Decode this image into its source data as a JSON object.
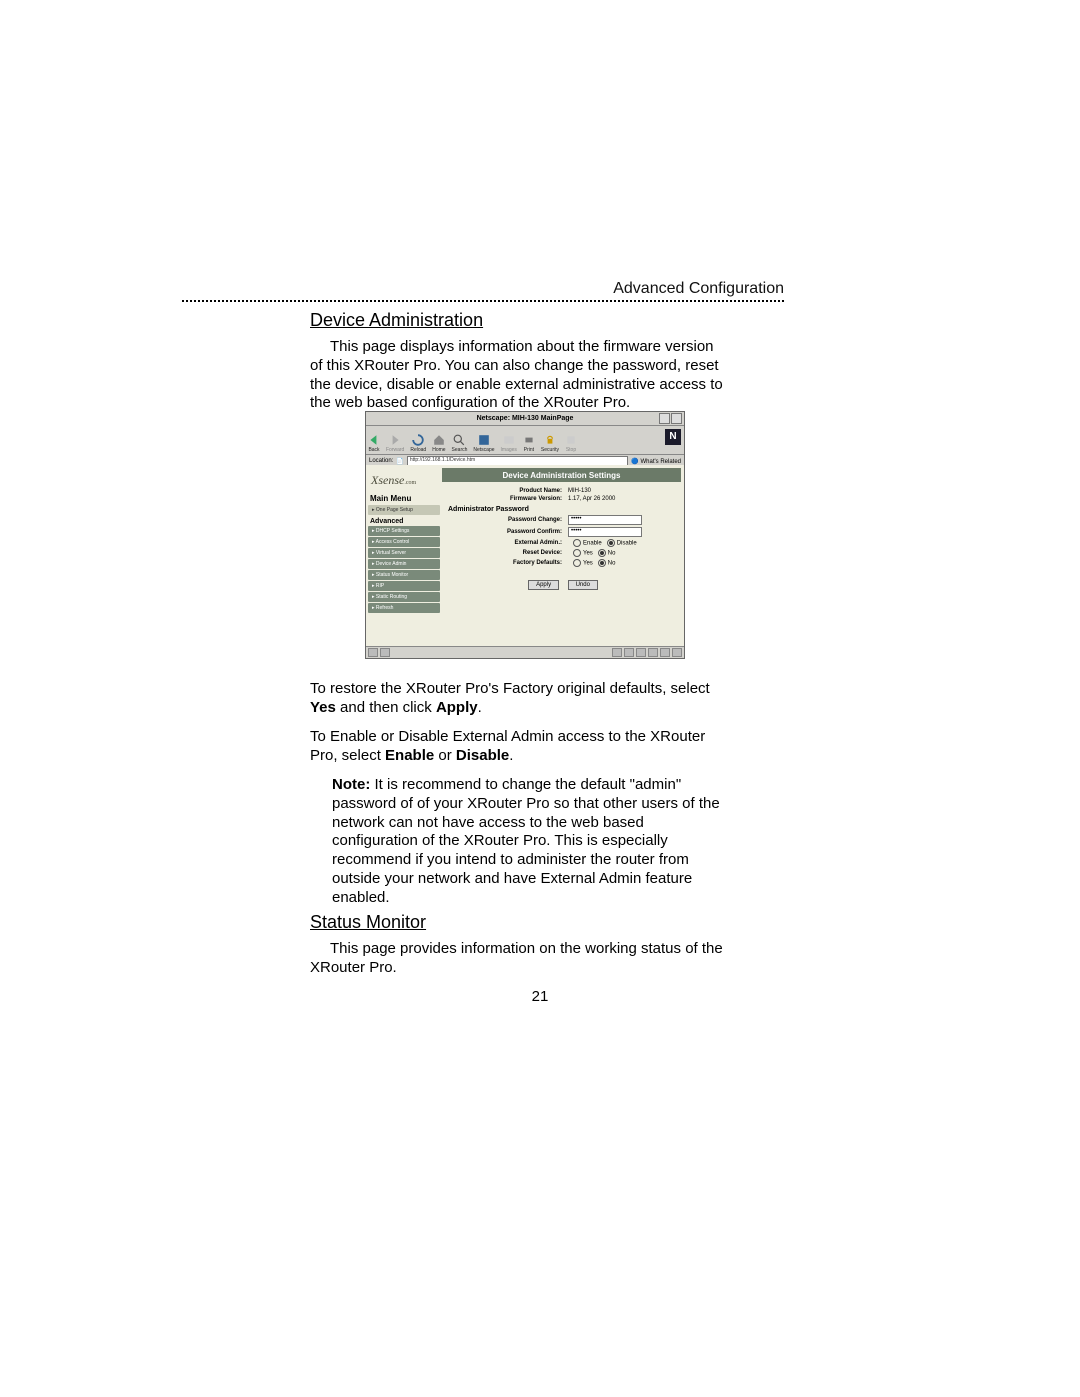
{
  "page": {
    "header": "Advanced Configuration",
    "page_number": "21"
  },
  "sections": {
    "device_admin": {
      "title": "Device Administration",
      "intro": "This page displays information about the firmware version of this XRouter Pro. You can also change the password, reset the device, disable or enable external administrative access to the web based configuration of the XRouter Pro.",
      "restore_prefix": "To restore the XRouter Pro's Factory original defaults, select ",
      "restore_bold1": "Yes",
      "restore_mid": " and then click ",
      "restore_bold2": "Apply",
      "restore_suffix": ".",
      "external_prefix": "To Enable or Disable External Admin access to the XRouter Pro, select ",
      "external_bold1": "Enable",
      "external_mid": " or ",
      "external_bold2": "Disable",
      "external_suffix": ".",
      "note_label": "Note:",
      "note_body": " It is recommend to change the default \"admin\" password of of your XRouter Pro so that other users of the network can not have access to the web based configuration of the XRouter Pro. This is especially recommend if you intend to administer the router from outside your network and have External Admin feature enabled."
    },
    "status_monitor": {
      "title": "Status Monitor",
      "intro": "This page provides information on the working status of the XRouter Pro."
    }
  },
  "screenshot": {
    "window_title": "Netscape: MIH-130 MainPage",
    "toolbar": {
      "back": "Back",
      "forward": "Forward",
      "reload": "Reload",
      "home": "Home",
      "search": "Search",
      "netscape": "Netscape",
      "images": "Images",
      "print": "Print",
      "security": "Security",
      "stop": "Stop"
    },
    "location_label": "Location:",
    "location_url": "http://192.168.1.1/Device.htm",
    "whats_related": "What's Related",
    "brand": "Xsense",
    "brand_suffix": ".com",
    "menu": {
      "main_menu": "Main Menu",
      "one_page_setup": "▸ One Page Setup",
      "advanced": "Advanced",
      "dhcp_settings": "▸ DHCP Settings",
      "access_control": "▸ Access Control",
      "virtual_server": "▸ Virtual Server",
      "device_admin": "▸ Device Admin",
      "status_monitor": "▸ Status Monitor",
      "rip": "▸ RIP",
      "static_routing": "▸ Static Routing",
      "refresh": "▸ Refresh"
    },
    "panel": {
      "banner": "Device Administration Settings",
      "product_name_label": "Product Name:",
      "product_name_value": "MIH-130",
      "firmware_label": "Firmware Version:",
      "firmware_value": "1.17, Apr 26 2000",
      "section_admin_pw": "Administrator Password",
      "pw_change_label": "Password Change:",
      "pw_change_value": "•••••",
      "pw_confirm_label": "Password Confirm:",
      "pw_confirm_value": "•••••",
      "ext_admin_label": "External Admin.:",
      "ext_admin_enable": "Enable",
      "ext_admin_disable": "Disable",
      "reset_label": "Reset Device:",
      "reset_yes": "Yes",
      "reset_no": "No",
      "factory_label": "Factory Defaults:",
      "factory_yes": "Yes",
      "factory_no": "No",
      "apply": "Apply",
      "undo": "Undo"
    }
  }
}
